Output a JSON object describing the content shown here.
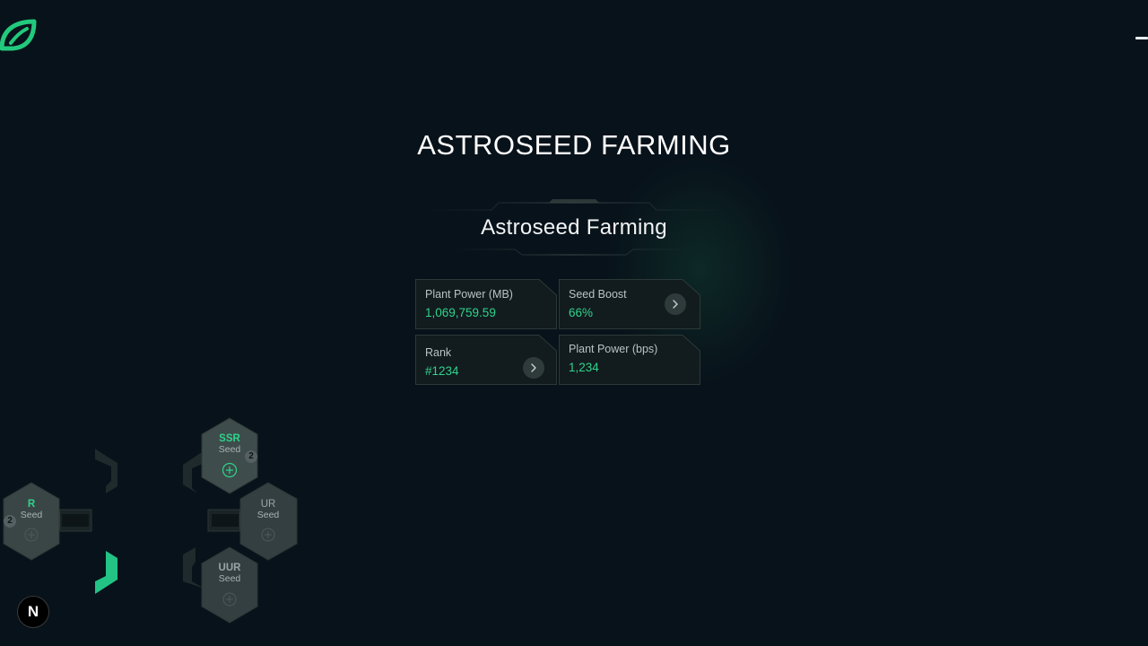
{
  "app": {
    "logo_icon": "leaf-icon",
    "accent_color": "#2fd38c"
  },
  "header": {
    "menu_icon": "hamburger-icon"
  },
  "hero": {
    "title": "ASTROSEED FARMING"
  },
  "panel": {
    "title": "Astroseed Farming",
    "stats": [
      {
        "label": "Plant Power (MB)",
        "value": "1,069,759.59"
      },
      {
        "label": "Seed Boost",
        "value": "66%"
      },
      {
        "label": "Rank",
        "value": "#1234"
      },
      {
        "label": "Plant Power (bps)",
        "value": "1,234"
      }
    ]
  },
  "seed_tree": {
    "nodes": [
      {
        "rank": "R",
        "sub": "Seed",
        "count": "2"
      },
      {
        "rank": "SSR",
        "sub": "Seed",
        "count": "2"
      },
      {
        "rank": "UR",
        "sub": "Seed"
      },
      {
        "rank": "UUR",
        "sub": "Seed"
      }
    ]
  },
  "dev": {
    "badge_label": "N"
  }
}
